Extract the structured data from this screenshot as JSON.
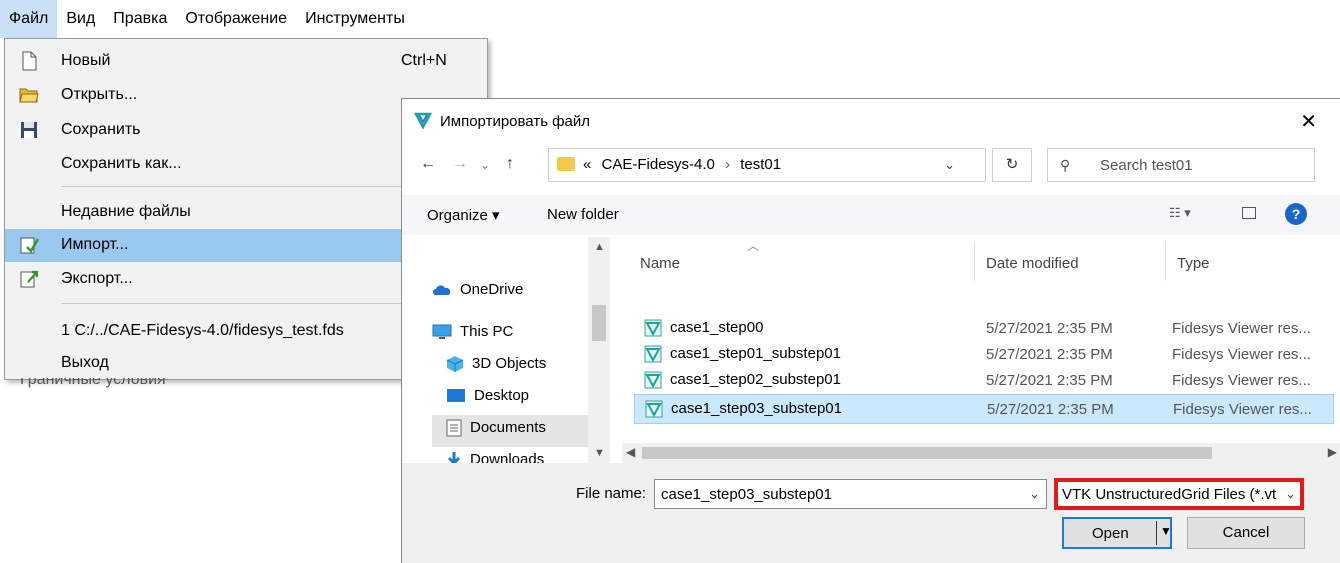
{
  "menubar": {
    "items": [
      "Файл",
      "Вид",
      "Правка",
      "Отображение",
      "Инструменты"
    ]
  },
  "file_menu": {
    "new_label": "Новый",
    "new_shortcut": "Ctrl+N",
    "open_label": "Открыть...",
    "save_label": "Сохранить",
    "save_as_label": "Сохранить как...",
    "recent_label": "Недавние файлы",
    "import_label": "Импорт...",
    "export_label": "Экспорт...",
    "recent_file_1": "1 C:/../CAE-Fidesys-4.0/fidesys_test.fds",
    "exit_label": "Выход",
    "behind_text": "Граничные условия"
  },
  "dialog": {
    "title": "Импортировать файл",
    "close": "✕",
    "breadcrumb": {
      "prefix": "«",
      "folder1": "CAE-Fidesys-4.0",
      "separator": "›",
      "folder2": "test01"
    },
    "search_placeholder": "Search test01",
    "toolbar": {
      "organize": "Organize ▾",
      "new_folder": "New folder"
    },
    "nav_items": [
      "OneDrive",
      "This PC",
      "3D Objects",
      "Desktop",
      "Documents",
      "Downloads"
    ],
    "columns": {
      "name": "Name",
      "date": "Date modified",
      "type": "Type"
    },
    "files": [
      {
        "name": "case1_step00",
        "date": "5/27/2021 2:35 PM",
        "type": "Fidesys Viewer res..."
      },
      {
        "name": "case1_step01_substep01",
        "date": "5/27/2021 2:35 PM",
        "type": "Fidesys Viewer res..."
      },
      {
        "name": "case1_step02_substep01",
        "date": "5/27/2021 2:35 PM",
        "type": "Fidesys Viewer res..."
      },
      {
        "name": "case1_step03_substep01",
        "date": "5/27/2021 2:35 PM",
        "type": "Fidesys Viewer res..."
      }
    ],
    "file_name_label": "File name:",
    "file_name_value": "case1_step03_substep01",
    "file_type_value": "VTK UnstructuredGrid Files (*.vt",
    "open_button": "Open",
    "cancel_button": "Cancel"
  },
  "colors": {
    "menu_highlight": "#99c9ef",
    "selected_row": "#cce8ff",
    "annotation_border": "#e01b1b",
    "open_button_border": "#1e7ad6"
  }
}
